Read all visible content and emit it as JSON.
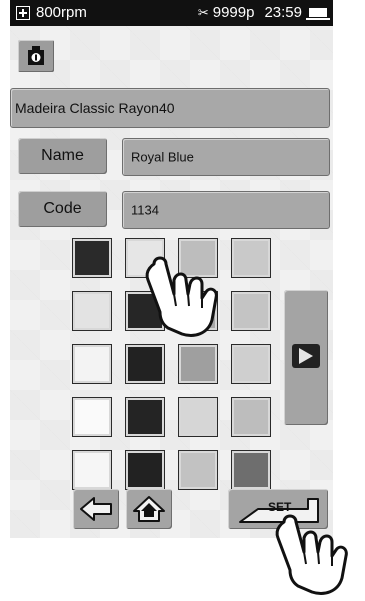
{
  "status": {
    "speed": "800rpm",
    "stitch_count": "9999p",
    "time": "23:59"
  },
  "thread": {
    "brand": "Madeira Classic Rayon40",
    "name_label": "Name",
    "name_value": "Royal Blue",
    "code_label": "Code",
    "code_value": "1134"
  },
  "palette": [
    [
      "#2a2a2a",
      "#e6e6e6",
      "#bdbdbd",
      "#c9c9c9"
    ],
    [
      "#e3e3e3",
      "#262626",
      "#a9a9a9",
      "#c4c4c4"
    ],
    [
      "#f3f3f3",
      "#222222",
      "#9f9f9f",
      "#cfcfcf"
    ],
    [
      "#fafafa",
      "#242424",
      "#d6d6d6",
      "#bdbdbd"
    ],
    [
      "#f6f6f6",
      "#222222",
      "#c2c2c2",
      "#6e6e6e"
    ]
  ],
  "buttons": {
    "set_label": "SET"
  },
  "icons": {
    "status_left": "plus-box-icon",
    "needle": "needle-icon",
    "battery": "battery-icon",
    "weight": "weight-icon",
    "next": "play-right-icon",
    "back": "back-arrow-icon",
    "home": "home-icon",
    "set": "set-enter-icon",
    "pointer": "pointing-hand-icon"
  }
}
